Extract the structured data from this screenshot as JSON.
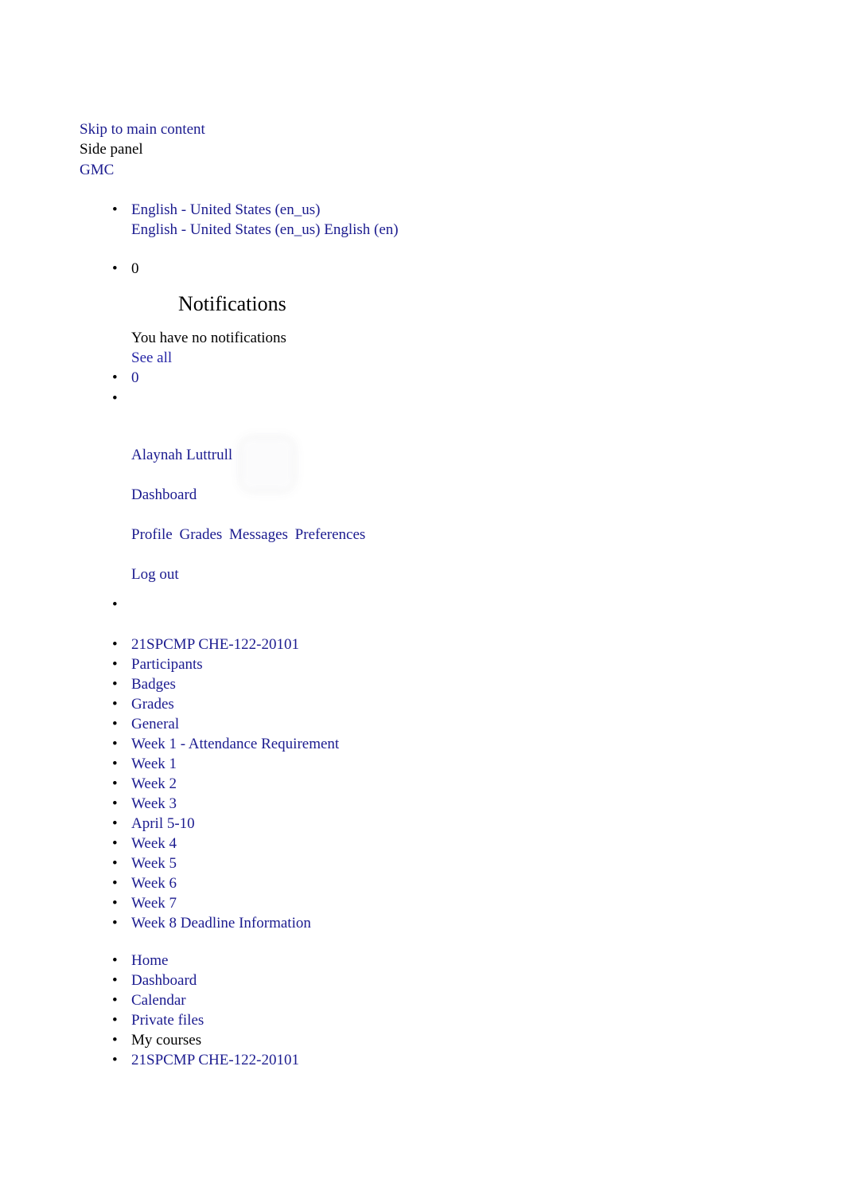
{
  "header": {
    "skip_link": "Skip to main content",
    "side_panel_label": "Side panel",
    "site_short_name": "GMC"
  },
  "language_menu": {
    "current": "English - United States (en_us)",
    "options_line": "English - United States (en_us) English (en)",
    "options": [
      "English - United States (en_us)",
      "English (en)"
    ]
  },
  "messages": {
    "count": "0"
  },
  "notifications": {
    "count": "0",
    "title": "Notifications",
    "empty_text": "You have no notifications",
    "see_all_label": "See all"
  },
  "user_menu": {
    "avatar_icon": "user-avatar-placeholder-icon",
    "name": "Alaynah Luttrull",
    "dashboard_label": "Dashboard",
    "links": [
      "Profile",
      "Grades",
      "Messages",
      "Preferences"
    ],
    "logout_label": "Log out"
  },
  "course_nav": {
    "items": [
      {
        "label": "21SPCMP CHE-122-20101",
        "is_link": true
      },
      {
        "label": "Participants",
        "is_link": true
      },
      {
        "label": "Badges",
        "is_link": true
      },
      {
        "label": "Grades",
        "is_link": true
      },
      {
        "label": "General",
        "is_link": true
      },
      {
        "label": "Week 1 - Attendance Requirement",
        "is_link": true
      },
      {
        "label": "Week 1",
        "is_link": true
      },
      {
        "label": "Week 2",
        "is_link": true
      },
      {
        "label": "Week 3",
        "is_link": true
      },
      {
        "label": "April 5-10",
        "is_link": true
      },
      {
        "label": "Week 4",
        "is_link": true
      },
      {
        "label": "Week 5",
        "is_link": true
      },
      {
        "label": "Week 6",
        "is_link": true
      },
      {
        "label": "Week 7",
        "is_link": true
      },
      {
        "label": "Week 8 Deadline Information",
        "is_link": true
      }
    ]
  },
  "site_nav": {
    "items": [
      {
        "label": "Home",
        "is_link": true
      },
      {
        "label": "Dashboard",
        "is_link": true
      },
      {
        "label": "Calendar",
        "is_link": true
      },
      {
        "label": "Private files",
        "is_link": true
      },
      {
        "label": "My courses",
        "is_link": false
      },
      {
        "label": "21SPCMP CHE-122-20101",
        "is_link": true
      }
    ]
  },
  "colors": {
    "link": "#1b1b8f",
    "link_bright": "#2626a6",
    "text": "#000000",
    "background": "#ffffff"
  }
}
